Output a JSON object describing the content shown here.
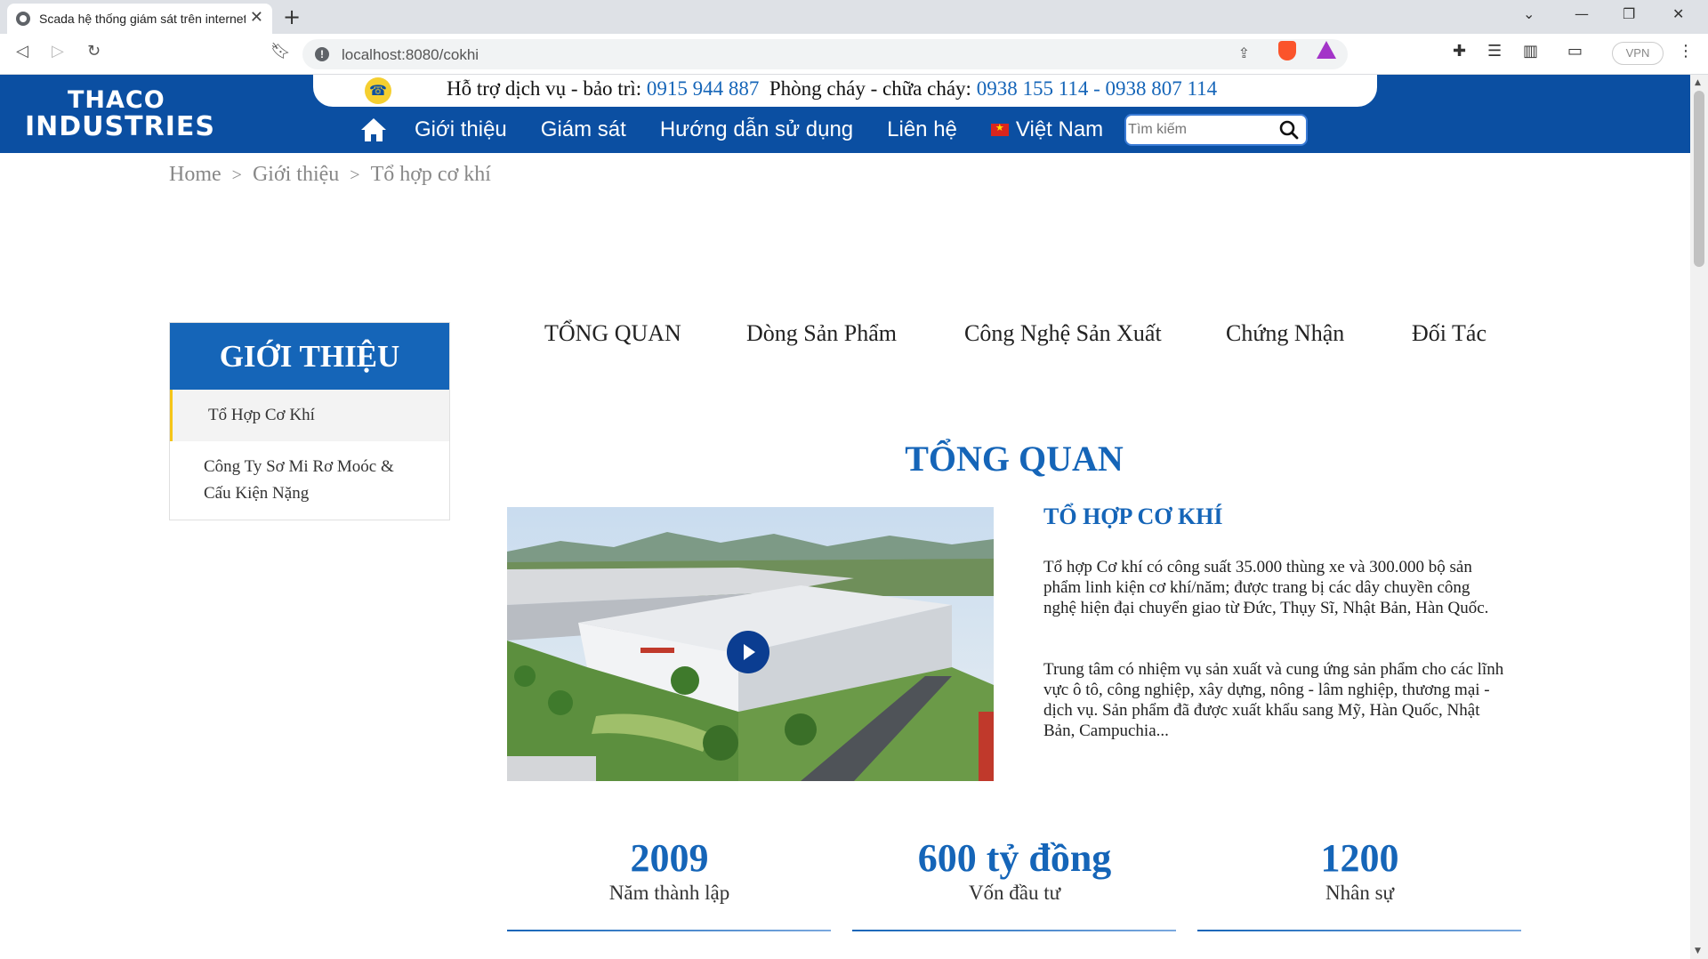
{
  "browser": {
    "tab_title": "Scada hệ thống giám sát trên internet",
    "url": "localhost:8080/cokhi",
    "vpn_label": "VPN"
  },
  "header": {
    "logo_line1": "THACO",
    "logo_line2": "INDUSTRIES",
    "hotline_prefix": "Hỗ trợ dịch vụ - bảo trì: ",
    "hotline_service": "0915 944 887",
    "hotline_fire_prefix": "  Phòng cháy - chữa cháy: ",
    "hotline_fire": "0938 155 114 - 0938 807 114",
    "nav": [
      "Giới thiệu",
      "Giám sát",
      "Hướng dẫn sử dụng",
      "Liên hệ"
    ],
    "language": "Việt Nam",
    "search_placeholder": "Tìm kiếm"
  },
  "breadcrumb": [
    "Home",
    "Giới thiệu",
    "Tổ hợp cơ khí"
  ],
  "sidebar": {
    "title": "GIỚI THIỆU",
    "items": [
      "Tổ Hợp Cơ Khí",
      "Công Ty Sơ Mi Rơ Moóc & Cấu Kiện Nặng"
    ]
  },
  "tabs": [
    "TỔNG QUAN",
    "Dòng Sản Phẩm",
    "Công Nghệ Sản Xuất",
    "Chứng Nhận",
    "Đối Tác"
  ],
  "content": {
    "section_title": "TỔNG QUAN",
    "heading": "TỔ HỢP CƠ KHÍ",
    "paragraph1": "Tổ hợp Cơ khí có công suất 35.000 thùng xe và 300.000 bộ sản phẩm linh kiện cơ khí/năm; được trang bị các dây chuyền công nghệ hiện đại chuyển giao từ Đức, Thụy Sĩ, Nhật Bản, Hàn Quốc.",
    "paragraph2": "Trung tâm có nhiệm vụ sản xuất và cung ứng sản phẩm cho các lĩnh vực ô tô, công nghiệp, xây dựng, nông - lâm nghiệp, thương mại - dịch vụ. Sản phẩm đã được xuất khẩu sang Mỹ, Hàn Quốc, Nhật Bản, Campuchia..."
  },
  "stats": [
    {
      "value": "2009",
      "label": "Năm thành lập"
    },
    {
      "value": "600 tỷ đồng",
      "label": "Vốn đầu tư"
    },
    {
      "value": "1200",
      "label": "Nhân sự"
    }
  ],
  "colors": {
    "brand_blue": "#0b4fa2",
    "accent_blue": "#1565b8",
    "active_marker": "#f5c518"
  }
}
